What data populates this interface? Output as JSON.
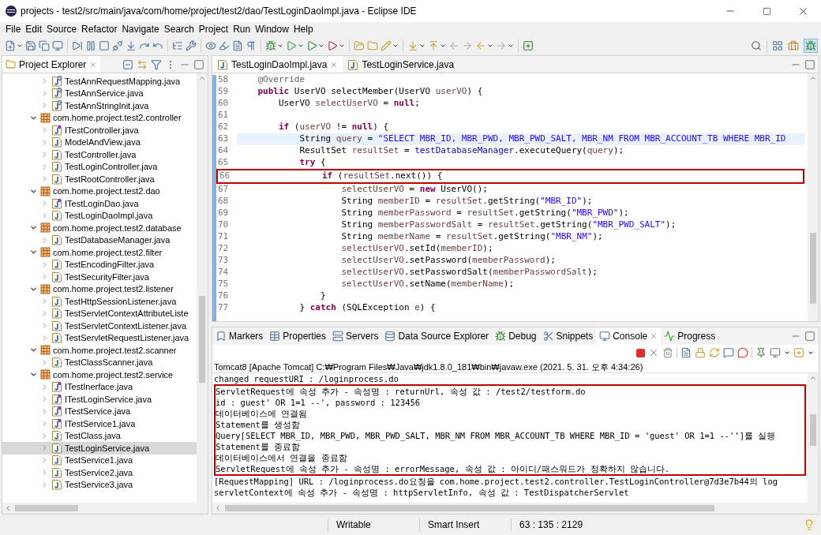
{
  "window": {
    "title": "projects - test2/src/main/java/com/home/project/test2/dao/TestLoginDaoImpl.java - Eclipse IDE"
  },
  "menu": [
    "File",
    "Edit",
    "Source",
    "Refactor",
    "Navigate",
    "Search",
    "Project",
    "Run",
    "Window",
    "Help"
  ],
  "explorer": {
    "title": "Project Explorer",
    "tree": [
      {
        "label": "TestAnnRequestMapping.java",
        "kind": "annotation",
        "selected": false
      },
      {
        "label": "TestAnnService.java",
        "kind": "annotation",
        "selected": false
      },
      {
        "label": "TestAnnStringInit.java",
        "kind": "annotation",
        "selected": false
      },
      {
        "label": "com.home.project.test2.controller",
        "kind": "package",
        "selected": false,
        "expanded": true,
        "children": [
          {
            "label": "ITestController.java",
            "kind": "interface",
            "selected": false
          },
          {
            "label": "ModelAndView.java",
            "kind": "class",
            "selected": false
          },
          {
            "label": "TestController.java",
            "kind": "class",
            "selected": false
          },
          {
            "label": "TestLoginController.java",
            "kind": "class",
            "selected": false
          },
          {
            "label": "TestRootController.java",
            "kind": "class",
            "selected": false
          }
        ]
      },
      {
        "label": "com.home.project.test2.dao",
        "kind": "package",
        "selected": false,
        "expanded": true,
        "children": [
          {
            "label": "ITestLoginDao.java",
            "kind": "interface",
            "selected": false
          },
          {
            "label": "TestLoginDaoImpl.java",
            "kind": "class",
            "selected": false
          }
        ]
      },
      {
        "label": "com.home.project.test2.database",
        "kind": "package",
        "selected": false,
        "expanded": true,
        "children": [
          {
            "label": "TestDatabaseManager.java",
            "kind": "class",
            "selected": false
          }
        ]
      },
      {
        "label": "com.home.project.test2.filter",
        "kind": "package",
        "selected": false,
        "expanded": true,
        "children": [
          {
            "label": "TestEncodingFilter.java",
            "kind": "class",
            "selected": false
          },
          {
            "label": "TestSecurityFilter.java",
            "kind": "class",
            "selected": false
          }
        ]
      },
      {
        "label": "com.home.project.test2.listener",
        "kind": "package",
        "selected": false,
        "expanded": true,
        "children": [
          {
            "label": "TestHttpSessionListener.java",
            "kind": "class",
            "selected": false
          },
          {
            "label": "TestServletContextAttributeListe",
            "kind": "class",
            "selected": false
          },
          {
            "label": "TestServletContextListener.java",
            "kind": "class",
            "selected": false
          },
          {
            "label": "TestServletRequestListener.java",
            "kind": "class",
            "selected": false
          }
        ]
      },
      {
        "label": "com.home.project.test2.scanner",
        "kind": "package",
        "selected": false,
        "expanded": true,
        "children": [
          {
            "label": "TestClassScanner.java",
            "kind": "class",
            "selected": false
          }
        ]
      },
      {
        "label": "com.home.project.test2.service",
        "kind": "package",
        "selected": false,
        "expanded": true,
        "children": [
          {
            "label": "ITestInerface.java",
            "kind": "interface",
            "selected": false
          },
          {
            "label": "ITestLoginService.java",
            "kind": "interface",
            "selected": false
          },
          {
            "label": "ITestService.java",
            "kind": "interface",
            "selected": false
          },
          {
            "label": "ITestService1.java",
            "kind": "interface",
            "selected": false
          },
          {
            "label": "TestClass.java",
            "kind": "class",
            "selected": false
          },
          {
            "label": "TestLoginService.java",
            "kind": "class",
            "selected": true
          },
          {
            "label": "TestService1.java",
            "kind": "class",
            "selected": false
          },
          {
            "label": "TestService2.java",
            "kind": "class",
            "selected": false
          },
          {
            "label": "TestService3.java",
            "kind": "class",
            "selected": false
          }
        ]
      }
    ]
  },
  "editor": {
    "tabs": [
      {
        "label": "TestLoginDaoImpl.java",
        "selected": true
      },
      {
        "label": "TestLoginService.java",
        "selected": false
      }
    ],
    "lines": [
      {
        "number": "58",
        "current": false,
        "boxed": false,
        "segments": [
          {
            "kind": "annotation",
            "text": "    @Override"
          }
        ]
      },
      {
        "number": "59",
        "current": false,
        "boxed": false,
        "segments": [
          {
            "kind": "keyword",
            "text": "    public"
          },
          {
            "kind": "plain",
            "text": " UserVO selectMember(UserVO "
          },
          {
            "kind": "variable",
            "text": "userVO"
          },
          {
            "kind": "plain",
            "text": ") {"
          }
        ]
      },
      {
        "number": "60",
        "current": false,
        "boxed": false,
        "segments": [
          {
            "kind": "plain",
            "text": "        UserVO "
          },
          {
            "kind": "variable",
            "text": "selectUserVO"
          },
          {
            "kind": "plain",
            "text": " = "
          },
          {
            "kind": "keyword",
            "text": "null"
          },
          {
            "kind": "plain",
            "text": ";"
          }
        ]
      },
      {
        "number": "61",
        "current": false,
        "boxed": false
      },
      {
        "number": "62",
        "current": false,
        "boxed": false,
        "segments": [
          {
            "kind": "keyword",
            "text": "        if"
          },
          {
            "kind": "plain",
            "text": " ("
          },
          {
            "kind": "variable",
            "text": "userVO"
          },
          {
            "kind": "plain",
            "text": " != "
          },
          {
            "kind": "keyword",
            "text": "null"
          },
          {
            "kind": "plain",
            "text": ") {"
          }
        ]
      },
      {
        "number": "63",
        "current": true,
        "boxed": false,
        "segments": [
          {
            "kind": "plain",
            "text": "            String "
          },
          {
            "kind": "variable",
            "text": "query"
          },
          {
            "kind": "plain",
            "text": " = "
          },
          {
            "kind": "string",
            "text": "\"SELECT MBR_ID, MBR_PWD, MBR_PWD_SALT, MBR_NM FROM MBR_ACCOUNT_TB WHERE MBR_ID"
          }
        ]
      },
      {
        "number": "64",
        "current": false,
        "boxed": false,
        "segments": [
          {
            "kind": "plain",
            "text": "            ResultSet "
          },
          {
            "kind": "variable",
            "text": "resultSet"
          },
          {
            "kind": "plain",
            "text": " = "
          },
          {
            "kind": "field",
            "text": "testDatabaseManager"
          },
          {
            "kind": "plain",
            "text": ".executeQuery("
          },
          {
            "kind": "variable",
            "text": "query"
          },
          {
            "kind": "plain",
            "text": ");"
          }
        ]
      },
      {
        "number": "65",
        "current": false,
        "boxed": false,
        "segments": [
          {
            "kind": "keyword",
            "text": "            try"
          },
          {
            "kind": "plain",
            "text": " {"
          }
        ]
      },
      {
        "number": "66",
        "current": false,
        "boxed": true,
        "segments": [
          {
            "kind": "keyword",
            "text": "                if"
          },
          {
            "kind": "plain",
            "text": " ("
          },
          {
            "kind": "variable",
            "text": "resultSet"
          },
          {
            "kind": "plain",
            "text": ".next()) {"
          }
        ]
      },
      {
        "number": "67",
        "current": false,
        "boxed": false,
        "segments": [
          {
            "kind": "variable",
            "text": "                    selectUserVO"
          },
          {
            "kind": "plain",
            "text": " = "
          },
          {
            "kind": "keyword",
            "text": "new"
          },
          {
            "kind": "plain",
            "text": " UserVO();"
          }
        ]
      },
      {
        "number": "68",
        "current": false,
        "boxed": false,
        "segments": [
          {
            "kind": "plain",
            "text": "                    String "
          },
          {
            "kind": "variable",
            "text": "memberID"
          },
          {
            "kind": "plain",
            "text": " = "
          },
          {
            "kind": "variable",
            "text": "resultSet"
          },
          {
            "kind": "plain",
            "text": ".getString("
          },
          {
            "kind": "string",
            "text": "\"MBR_ID\""
          },
          {
            "kind": "plain",
            "text": ");"
          }
        ]
      },
      {
        "number": "69",
        "current": false,
        "boxed": false,
        "segments": [
          {
            "kind": "plain",
            "text": "                    String "
          },
          {
            "kind": "variable",
            "text": "memberPassword"
          },
          {
            "kind": "plain",
            "text": " = "
          },
          {
            "kind": "variable",
            "text": "resultSet"
          },
          {
            "kind": "plain",
            "text": ".getString("
          },
          {
            "kind": "string",
            "text": "\"MBR_PWD\""
          },
          {
            "kind": "plain",
            "text": ");"
          }
        ]
      },
      {
        "number": "70",
        "current": false,
        "boxed": false,
        "segments": [
          {
            "kind": "plain",
            "text": "                    String "
          },
          {
            "kind": "variable",
            "text": "memberPasswordSalt"
          },
          {
            "kind": "plain",
            "text": " = "
          },
          {
            "kind": "variable",
            "text": "resultSet"
          },
          {
            "kind": "plain",
            "text": ".getString("
          },
          {
            "kind": "string",
            "text": "\"MBR_PWD_SALT\""
          },
          {
            "kind": "plain",
            "text": ");"
          }
        ]
      },
      {
        "number": "71",
        "current": false,
        "boxed": false,
        "segments": [
          {
            "kind": "plain",
            "text": "                    String "
          },
          {
            "kind": "variable",
            "text": "memberName"
          },
          {
            "kind": "plain",
            "text": " = "
          },
          {
            "kind": "variable",
            "text": "resultSet"
          },
          {
            "kind": "plain",
            "text": ".getString("
          },
          {
            "kind": "string",
            "text": "\"MBR_NM\""
          },
          {
            "kind": "plain",
            "text": ");"
          }
        ]
      },
      {
        "number": "72",
        "current": false,
        "boxed": false,
        "segments": [
          {
            "kind": "variable",
            "text": "                    selectUserVO"
          },
          {
            "kind": "plain",
            "text": ".setId("
          },
          {
            "kind": "variable",
            "text": "memberID"
          },
          {
            "kind": "plain",
            "text": ");"
          }
        ]
      },
      {
        "number": "73",
        "current": false,
        "boxed": false,
        "segments": [
          {
            "kind": "variable",
            "text": "                    selectUserVO"
          },
          {
            "kind": "plain",
            "text": ".setPassword("
          },
          {
            "kind": "variable",
            "text": "memberPassword"
          },
          {
            "kind": "plain",
            "text": ");"
          }
        ]
      },
      {
        "number": "74",
        "current": false,
        "boxed": false,
        "segments": [
          {
            "kind": "variable",
            "text": "                    selectUserVO"
          },
          {
            "kind": "plain",
            "text": ".setPasswordSalt("
          },
          {
            "kind": "variable",
            "text": "memberPasswordSalt"
          },
          {
            "kind": "plain",
            "text": ");"
          }
        ]
      },
      {
        "number": "75",
        "current": false,
        "boxed": false,
        "segments": [
          {
            "kind": "variable",
            "text": "                    selectUserVO"
          },
          {
            "kind": "plain",
            "text": ".setName("
          },
          {
            "kind": "variable",
            "text": "memberName"
          },
          {
            "kind": "plain",
            "text": ");"
          }
        ]
      },
      {
        "number": "76",
        "current": false,
        "boxed": false,
        "segments": [
          {
            "kind": "plain",
            "text": "                }"
          }
        ]
      },
      {
        "number": "77",
        "current": false,
        "boxed": false,
        "segments": [
          {
            "kind": "plain",
            "text": "            } "
          },
          {
            "kind": "keyword",
            "text": "catch"
          },
          {
            "kind": "plain",
            "text": " (SQLException "
          },
          {
            "kind": "variable",
            "text": "e"
          },
          {
            "kind": "plain",
            "text": ") {"
          }
        ]
      }
    ]
  },
  "console_panel": {
    "tabs": [
      {
        "label": "Markers",
        "selected": false
      },
      {
        "label": "Properties",
        "selected": false
      },
      {
        "label": "Servers",
        "selected": false
      },
      {
        "label": "Data Source Explorer",
        "selected": false
      },
      {
        "label": "Debug",
        "selected": false
      },
      {
        "label": "Snippets",
        "selected": false
      },
      {
        "label": "Console",
        "selected": true
      },
      {
        "label": "Progress",
        "selected": false
      }
    ],
    "process": "Tomcat8 [Apache Tomcat] C:₩Program Files₩Java₩jdk1.8.0_181₩bin₩javaw.exe  (2021. 5. 31. 오후 4:34:26)",
    "lines": [
      {
        "text": "changed requestURI : /loginprocess.do",
        "boxed": false
      },
      {
        "text": "ServletRequest에 속성 추가 - 속성명 : returnUrl, 속성 값 : /test2/testform.do",
        "boxed": true
      },
      {
        "text": "id : guest' OR 1=1 --', password : 123456",
        "boxed": true
      },
      {
        "text": "데이터베이스에 연결됨",
        "boxed": true
      },
      {
        "text": "Statement를 생성함",
        "boxed": true
      },
      {
        "text": "Query[SELECT MBR_ID, MBR_PWD, MBR_PWD_SALT, MBR_NM FROM MBR_ACCOUNT_TB WHERE MBR_ID = 'guest' OR 1=1 --'']를 실행",
        "boxed": true
      },
      {
        "text": "Statement를 종료함",
        "boxed": true
      },
      {
        "text": "데이터베이스에서 연결을 종료함",
        "boxed": true
      },
      {
        "text": "ServletRequest에 속성 추가 - 속성명 : errorMessage, 속성 값 : 아이디/패스워드가 정확하지 않습니다.",
        "boxed": true
      },
      {
        "text": "[RequestMapping] URL : /loginprocess.do요청을 com.home.project.test2.controller.TestLoginController@7d3e7b44의 log",
        "boxed": false
      },
      {
        "text": "servletContext에 속성 추가 - 속성명 : httpServletInfo, 속성 값 : TestDispatcherServlet",
        "boxed": false
      }
    ]
  },
  "status_bar": {
    "items": [
      "Writable",
      "Smart Insert",
      "63 : 135 : 2129"
    ]
  }
}
